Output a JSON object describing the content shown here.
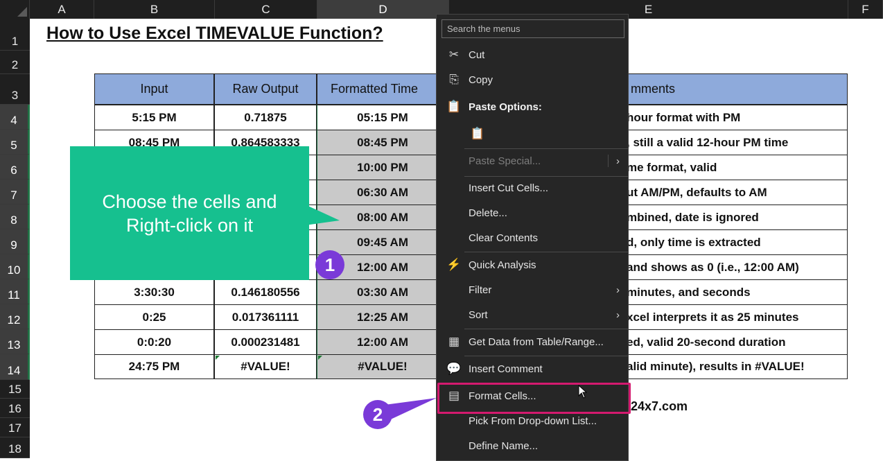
{
  "sheet": {
    "columns": [
      "A",
      "B",
      "C",
      "D",
      "E",
      "F"
    ],
    "rows": [
      "1",
      "2",
      "3",
      "4",
      "5",
      "6",
      "7",
      "8",
      "9",
      "10",
      "11",
      "12",
      "13",
      "14",
      "15",
      "16",
      "17",
      "18"
    ],
    "title": "How to Use Excel TIMEVALUE Function?",
    "footer_partial": "el24x7.com"
  },
  "table": {
    "headers": [
      "Input",
      "Raw Output",
      "Formatted Time",
      "mments"
    ],
    "rows": [
      {
        "input": "5:15 PM",
        "raw": "0.71875",
        "formatted": "05:15 PM",
        "comment": "hour format with PM"
      },
      {
        "input": "08:45 PM",
        "raw": "0.864583333",
        "formatted": "08:45 PM",
        "comment": ", still a valid 12-hour PM time"
      },
      {
        "input": "",
        "raw": "",
        "formatted": "10:00 PM",
        "comment": "me format, valid"
      },
      {
        "input": "",
        "raw": "",
        "formatted": "06:30 AM",
        "comment": "ut AM/PM, defaults to AM"
      },
      {
        "input": "",
        "raw": "",
        "formatted": "08:00 AM",
        "comment": "mbined, date is ignored"
      },
      {
        "input": "",
        "raw": "",
        "formatted": "09:45 AM",
        "comment": "d, only time is extracted"
      },
      {
        "input": "",
        "raw": "",
        "formatted": "12:00 AM",
        "comment": "and shows as 0 (i.e., 12:00 AM)"
      },
      {
        "input": "3:30:30",
        "raw": "0.146180556",
        "formatted": "03:30 AM",
        "comment": "minutes, and seconds"
      },
      {
        "input": "0:25",
        "raw": "0.017361111",
        "formatted": "12:25 AM",
        "comment": "xcel interprets it as 25 minutes"
      },
      {
        "input": "0:0:20",
        "raw": "0.000231481",
        "formatted": "12:00 AM",
        "comment": "ed, valid 20-second duration"
      },
      {
        "input": "24:75 PM",
        "raw": "#VALUE!",
        "formatted": "#VALUE!",
        "comment": "alid minute), results in #VALUE!"
      }
    ]
  },
  "callout": {
    "line1": "Choose the cells and",
    "line2": "Right-click on it",
    "step1": "1",
    "step2": "2"
  },
  "menu": {
    "search_placeholder": "Search the menus",
    "cut": "Cut",
    "copy": "Copy",
    "paste_options": "Paste Options:",
    "paste_special": "Paste Special...",
    "insert_cut_cells": "Insert Cut Cells...",
    "delete": "Delete...",
    "clear_contents": "Clear Contents",
    "quick_analysis": "Quick Analysis",
    "filter": "Filter",
    "sort": "Sort",
    "get_data": "Get Data from Table/Range...",
    "insert_comment": "Insert Comment",
    "format_cells": "Format Cells...",
    "pick_dropdown": "Pick From Drop-down List...",
    "define_name": "Define Name..."
  },
  "colors": {
    "header_fill": "#8eaadb",
    "selection_fill": "#c9c9c9",
    "callout": "#16c08f",
    "badge": "#7a3ad8",
    "highlight": "#d41a6f",
    "menu_bg": "#262626"
  }
}
